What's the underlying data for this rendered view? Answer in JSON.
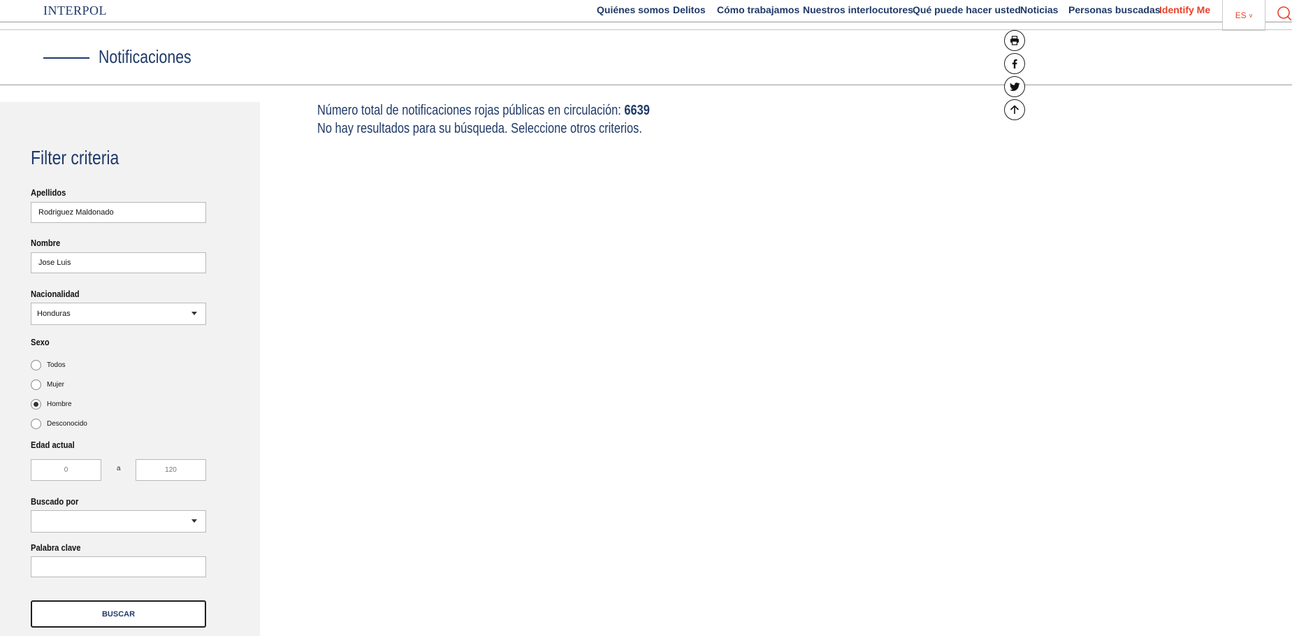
{
  "header": {
    "logo": "INTERPOL",
    "nav": [
      {
        "label": "Quiénes somos"
      },
      {
        "label": "Delitos"
      },
      {
        "label": "Cómo trabajamos"
      },
      {
        "label": "Nuestros interlocutores"
      },
      {
        "label": "Qué puede hacer usted"
      },
      {
        "label": "Noticias"
      },
      {
        "label": "Personas buscadas"
      },
      {
        "label": "Identify Me"
      }
    ],
    "language": "ES",
    "language_chevron": "v",
    "highlight_color": "#e8432b",
    "brand_color": "#1f3a68"
  },
  "page": {
    "title": "Notificaciones"
  },
  "share_icons": [
    "print-icon",
    "facebook-icon",
    "twitter-icon",
    "back-to-top-icon"
  ],
  "filters": {
    "title": "Filter criteria",
    "surname": {
      "label": "Apellidos",
      "value": "Rodriguez Maldonado"
    },
    "name": {
      "label": "Nombre",
      "value": "Jose Luis"
    },
    "nationality": {
      "label": "Nacionalidad",
      "value": "Honduras"
    },
    "sex": {
      "label": "Sexo",
      "options": [
        {
          "label": "Todos",
          "checked": false
        },
        {
          "label": "Mujer",
          "checked": false
        },
        {
          "label": "Hombre",
          "checked": true
        },
        {
          "label": "Desconocido",
          "checked": false
        }
      ]
    },
    "age": {
      "label": "Edad actual",
      "min": "0",
      "separator": "a",
      "max": "120"
    },
    "wanted_by": {
      "label": "Buscado por",
      "value": ""
    },
    "keyword": {
      "label": "Palabra clave",
      "value": ""
    },
    "submit_label": "BUSCAR"
  },
  "results": {
    "total_label": "Número total de notificaciones rojas públicas en circulación:",
    "total_count": "6639",
    "empty_message": "No hay resultados para su búsqueda. Seleccione otros criterios."
  }
}
